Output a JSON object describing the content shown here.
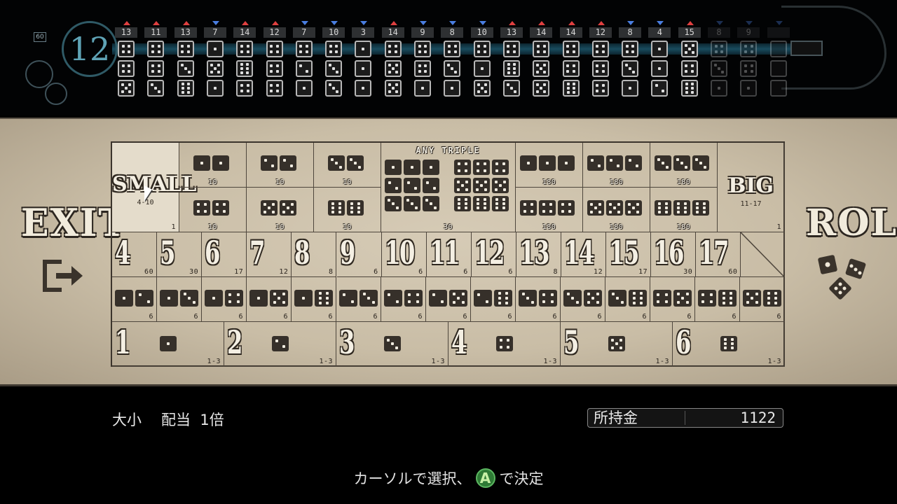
{
  "history": {
    "roll_count": "60",
    "round_number": "12",
    "columns": [
      {
        "sum": "13",
        "type": "big",
        "dice": [
          4,
          4,
          5
        ]
      },
      {
        "sum": "11",
        "type": "big",
        "dice": [
          4,
          4,
          3
        ]
      },
      {
        "sum": "13",
        "type": "big",
        "dice": [
          4,
          3,
          6
        ]
      },
      {
        "sum": "7",
        "type": "small",
        "dice": [
          1,
          5,
          1
        ]
      },
      {
        "sum": "14",
        "type": "big",
        "dice": [
          4,
          6,
          4
        ]
      },
      {
        "sum": "12",
        "type": "big",
        "dice": [
          4,
          4,
          4
        ]
      },
      {
        "sum": "7",
        "type": "small",
        "dice": [
          4,
          2,
          1
        ]
      },
      {
        "sum": "10",
        "type": "small",
        "dice": [
          4,
          3,
          3
        ]
      },
      {
        "sum": "3",
        "type": "small",
        "dice": [
          1,
          1,
          1
        ]
      },
      {
        "sum": "14",
        "type": "big",
        "dice": [
          4,
          5,
          5
        ]
      },
      {
        "sum": "9",
        "type": "small",
        "dice": [
          4,
          4,
          1
        ]
      },
      {
        "sum": "8",
        "type": "small",
        "dice": [
          4,
          3,
          1
        ]
      },
      {
        "sum": "10",
        "type": "small",
        "dice": [
          4,
          1,
          5
        ]
      },
      {
        "sum": "13",
        "type": "big",
        "dice": [
          4,
          6,
          3
        ]
      },
      {
        "sum": "14",
        "type": "big",
        "dice": [
          4,
          5,
          5
        ]
      },
      {
        "sum": "14",
        "type": "big",
        "dice": [
          4,
          4,
          6
        ]
      },
      {
        "sum": "12",
        "type": "big",
        "dice": [
          4,
          4,
          4
        ]
      },
      {
        "sum": "8",
        "type": "small",
        "dice": [
          4,
          3,
          1
        ]
      },
      {
        "sum": "4",
        "type": "small",
        "dice": [
          1,
          1,
          2
        ]
      },
      {
        "sum": "15",
        "type": "big",
        "dice": [
          5,
          4,
          6
        ]
      },
      {
        "sum": "8",
        "type": "small",
        "dice": [
          4,
          3,
          1
        ],
        "dim": true
      },
      {
        "sum": "9",
        "type": "small",
        "dice": [
          4,
          4,
          1
        ],
        "dim": true
      },
      {
        "sum": "",
        "type": "small",
        "dice": [],
        "dim": true
      }
    ]
  },
  "side": {
    "exit_label": "EXIT",
    "roll_label": "ROLL"
  },
  "board": {
    "small": {
      "label": "SMALL",
      "range": "4-10",
      "odds": "1"
    },
    "big": {
      "label": "BIG",
      "range": "11-17",
      "odds": "1"
    },
    "any_triple": {
      "label": "ANY TRIPLE",
      "odds": "30"
    },
    "doubles": [
      {
        "face": 1,
        "odds": "10"
      },
      {
        "face": 2,
        "odds": "10"
      },
      {
        "face": 3,
        "odds": "10"
      },
      {
        "face": 4,
        "odds": "10"
      },
      {
        "face": 5,
        "odds": "10"
      },
      {
        "face": 6,
        "odds": "10"
      }
    ],
    "triples": [
      {
        "face": 1,
        "odds": "180"
      },
      {
        "face": 2,
        "odds": "180"
      },
      {
        "face": 3,
        "odds": "180"
      },
      {
        "face": 4,
        "odds": "180"
      },
      {
        "face": 5,
        "odds": "180"
      },
      {
        "face": 6,
        "odds": "180"
      }
    ],
    "sums": [
      {
        "n": "4",
        "odds": "60"
      },
      {
        "n": "5",
        "odds": "30"
      },
      {
        "n": "6",
        "odds": "17"
      },
      {
        "n": "7",
        "odds": "12"
      },
      {
        "n": "8",
        "odds": "8"
      },
      {
        "n": "9",
        "odds": "6"
      },
      {
        "n": "10",
        "odds": "6"
      },
      {
        "n": "11",
        "odds": "6"
      },
      {
        "n": "12",
        "odds": "6"
      },
      {
        "n": "13",
        "odds": "8"
      },
      {
        "n": "14",
        "odds": "12"
      },
      {
        "n": "15",
        "odds": "17"
      },
      {
        "n": "16",
        "odds": "30"
      },
      {
        "n": "17",
        "odds": "60"
      }
    ],
    "combos": [
      {
        "a": 1,
        "b": 2,
        "odds": "6"
      },
      {
        "a": 1,
        "b": 3,
        "odds": "6"
      },
      {
        "a": 1,
        "b": 4,
        "odds": "6"
      },
      {
        "a": 1,
        "b": 5,
        "odds": "6"
      },
      {
        "a": 1,
        "b": 6,
        "odds": "6"
      },
      {
        "a": 2,
        "b": 3,
        "odds": "6"
      },
      {
        "a": 2,
        "b": 4,
        "odds": "6"
      },
      {
        "a": 2,
        "b": 5,
        "odds": "6"
      },
      {
        "a": 2,
        "b": 6,
        "odds": "6"
      },
      {
        "a": 3,
        "b": 4,
        "odds": "6"
      },
      {
        "a": 3,
        "b": 5,
        "odds": "6"
      },
      {
        "a": 3,
        "b": 6,
        "odds": "6"
      },
      {
        "a": 4,
        "b": 5,
        "odds": "6"
      },
      {
        "a": 4,
        "b": 6,
        "odds": "6"
      },
      {
        "a": 5,
        "b": 6,
        "odds": "6"
      }
    ],
    "singles": [
      {
        "n": "1",
        "face": 1,
        "odds": "1-3"
      },
      {
        "n": "2",
        "face": 2,
        "odds": "1-3"
      },
      {
        "n": "3",
        "face": 3,
        "odds": "1-3"
      },
      {
        "n": "4",
        "face": 4,
        "odds": "1-3"
      },
      {
        "n": "5",
        "face": 5,
        "odds": "1-3"
      },
      {
        "n": "6",
        "face": 6,
        "odds": "1-3"
      }
    ]
  },
  "status": {
    "bet_name": "大小",
    "payout_label": "配当",
    "payout_value": "1倍",
    "money_label": "所持金",
    "money_value": "1122"
  },
  "hint": {
    "before": "カーソルで選択、",
    "button": "A",
    "after": "で決定"
  },
  "colors": {
    "big_marker": "#e04040",
    "small_marker": "#4a7ee0",
    "confirm_button": "#2e7a35"
  }
}
